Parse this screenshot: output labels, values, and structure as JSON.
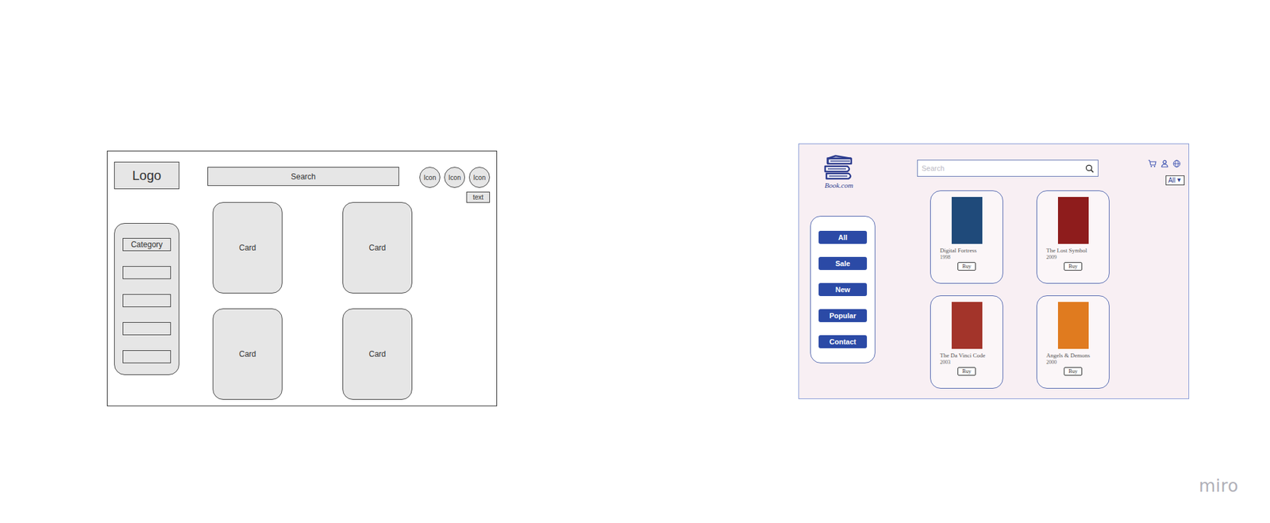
{
  "board": {
    "watermark": "miro"
  },
  "wireframe": {
    "logo": "Logo",
    "search": "Search",
    "icons": [
      "Icon",
      "Icon",
      "Icon"
    ],
    "text": "text",
    "categories": [
      "Category",
      "",
      "",
      "",
      ""
    ],
    "cards": [
      "Card",
      "Card",
      "Card",
      "Card"
    ]
  },
  "mockup": {
    "logo": "Book.com",
    "search": {
      "placeholder": "Search"
    },
    "filter": {
      "value": "All",
      "arrow": "▼"
    },
    "categories": [
      "All",
      "Sale",
      "New",
      "Popular",
      "Contact"
    ],
    "books": [
      {
        "title": "Digital Fortress",
        "year": "1998",
        "button": "Buy",
        "color": "#1f4a7a"
      },
      {
        "title": "The Lost Symbol",
        "year": "2009",
        "button": "Buy",
        "color": "#8e1c1c"
      },
      {
        "title": "The Da Vinci Code",
        "year": "2003",
        "button": "Buy",
        "color": "#a3342a"
      },
      {
        "title": "Angels & Demons",
        "year": "2000",
        "button": "Buy",
        "color": "#e07b1f"
      }
    ]
  }
}
